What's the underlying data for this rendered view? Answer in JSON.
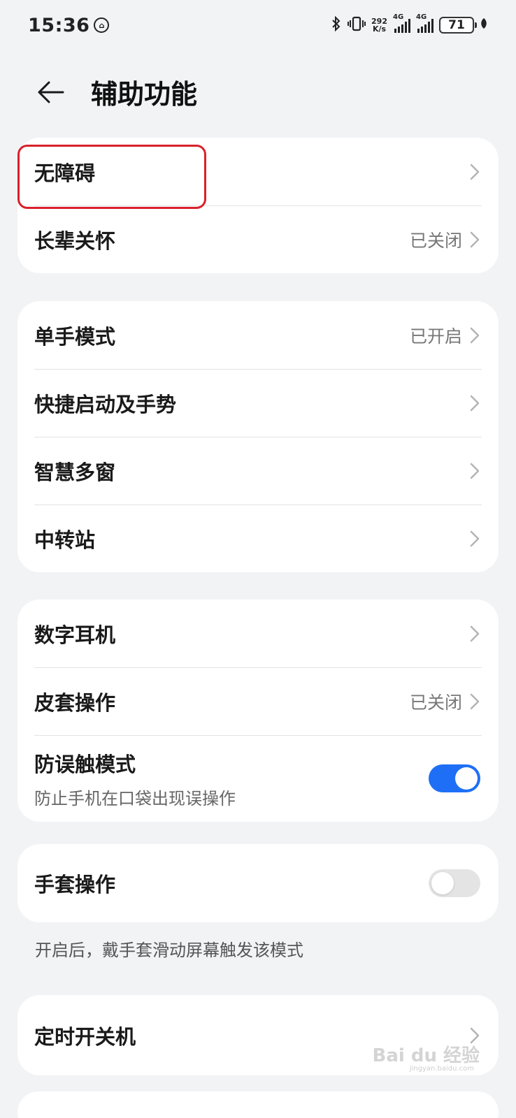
{
  "status_bar": {
    "time": "15:36",
    "net_speed_value": "292",
    "net_speed_unit": "K/s",
    "sim1_label": "4G",
    "sim2_label": "4G",
    "battery": "71"
  },
  "header": {
    "title": "辅助功能"
  },
  "groups": [
    {
      "items": [
        {
          "title": "无障碍",
          "value": ""
        },
        {
          "title": "长辈关怀",
          "value": "已关闭"
        }
      ]
    },
    {
      "items": [
        {
          "title": "单手模式",
          "value": "已开启"
        },
        {
          "title": "快捷启动及手势",
          "value": ""
        },
        {
          "title": "智慧多窗",
          "value": ""
        },
        {
          "title": "中转站",
          "value": ""
        }
      ]
    },
    {
      "items": [
        {
          "title": "数字耳机",
          "value": ""
        },
        {
          "title": "皮套操作",
          "value": "已关闭"
        },
        {
          "title": "防误触模式",
          "subtitle": "防止手机在口袋出现误操作",
          "toggle": true
        }
      ]
    },
    {
      "items": [
        {
          "title": "手套操作",
          "toggle": false
        }
      ]
    },
    {
      "items": [
        {
          "title": "定时开关机",
          "value": ""
        }
      ]
    }
  ],
  "glove_note": "开启后，戴手套滑动屏幕触发该模式",
  "watermark": "Bai du 经验",
  "watermark_url": "jingyan.baidu.com",
  "colors": {
    "accent": "#1e6ff5",
    "highlight": "#d9212b",
    "background": "#f1f3f5"
  }
}
